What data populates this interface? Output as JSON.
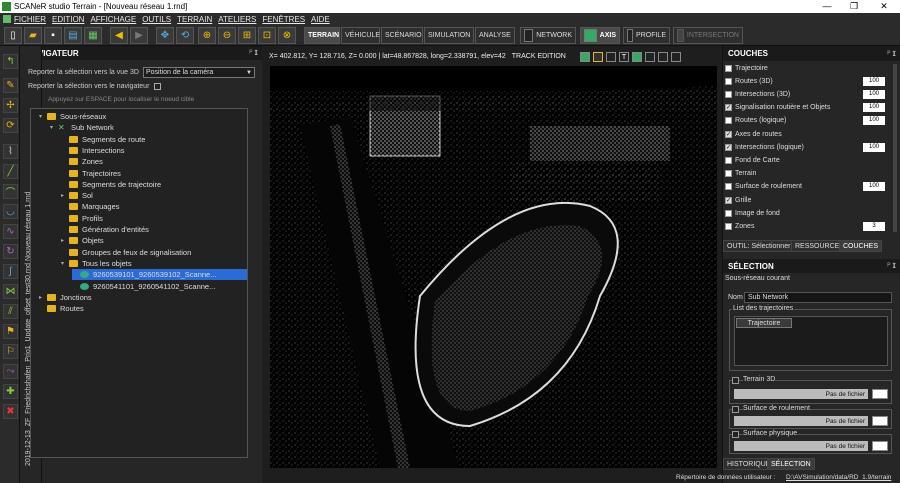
{
  "window": {
    "title": "SCANeR studio Terrain - [Nouveau réseau 1.rnd]",
    "minimize": "—",
    "maximize": "❐",
    "close": "✕"
  },
  "menu": [
    "FICHIER",
    "EDITION",
    "AFFICHAGE",
    "OUTILS",
    "TERRAIN",
    "ATELIERS",
    "FENÊTRES",
    "AIDE"
  ],
  "modes": {
    "terrain": "TERRAIN",
    "vehicule": "VÉHICULE",
    "scenario": "SCÉNARIO",
    "simulation": "SIMULATION",
    "analyse": "ANALYSE",
    "network": "NETWORK",
    "axis": "AXIS",
    "profile": "PROFILE",
    "intersection": "INTERSECTION"
  },
  "navigator": {
    "title": "NAVIGATEUR",
    "pin": "ᴾ 𝗜",
    "report_3d_label": "Reporter la sélection vers la vue 3D",
    "report_3d_value": "Position de la caméra",
    "report_nav_label": "Reporter la sélection vers le navigateur",
    "search_placeholder": "Appuyez sur ESPACE pour localiser le noeud cible",
    "tabs_vertical": "2019-12-13_ZF_Friedrichshafen_Prio1_Update_offset_test30.rnd    Nouveau réseau 1.rnd",
    "tree": [
      {
        "label": "Sous-réseaux",
        "level": 0,
        "arrow": "▾",
        "kind": "folder"
      },
      {
        "label": "Sub Network",
        "level": 1,
        "arrow": "▾",
        "kind": "network"
      },
      {
        "label": "Segments de route",
        "level": 2,
        "arrow": "",
        "kind": "folder"
      },
      {
        "label": "Intersections",
        "level": 2,
        "arrow": "",
        "kind": "folder"
      },
      {
        "label": "Zones",
        "level": 2,
        "arrow": "",
        "kind": "folder"
      },
      {
        "label": "Trajectoires",
        "level": 2,
        "arrow": "",
        "kind": "folder"
      },
      {
        "label": "Segments de trajectoire",
        "level": 2,
        "arrow": "",
        "kind": "folder"
      },
      {
        "label": "Sol",
        "level": 2,
        "arrow": "▸",
        "kind": "folder"
      },
      {
        "label": "Marquages",
        "level": 2,
        "arrow": "",
        "kind": "folder"
      },
      {
        "label": "Profils",
        "level": 2,
        "arrow": "",
        "kind": "folder"
      },
      {
        "label": "Génération d'entités",
        "level": 2,
        "arrow": "",
        "kind": "folder"
      },
      {
        "label": "Objets",
        "level": 2,
        "arrow": "▸",
        "kind": "folder"
      },
      {
        "label": "Groupes de feux de signalisation",
        "level": 2,
        "arrow": "",
        "kind": "folder"
      },
      {
        "label": "Tous les objets",
        "level": 2,
        "arrow": "▾",
        "kind": "folder"
      },
      {
        "label": "9260539101_9260539102_Scanne...",
        "level": 3,
        "arrow": "",
        "kind": "scan",
        "selected": true
      },
      {
        "label": "9260541101_9260541102_Scanne...",
        "level": 3,
        "arrow": "",
        "kind": "scan"
      },
      {
        "label": "Jonctions",
        "level": 0,
        "arrow": "▸",
        "kind": "folder"
      },
      {
        "label": "Routes",
        "level": 0,
        "arrow": "",
        "kind": "folder"
      }
    ]
  },
  "viewport": {
    "coords": "X= 402.812, Y= 128.716, Z=  0.000 | lat=48.867828, long=2.338791, elev=42",
    "track_edition": "TRACK EDITION"
  },
  "layers": {
    "title": "COUCHES",
    "pin": "ᴾ 𝗜",
    "items": [
      {
        "label": "Trajectoire",
        "checked": false,
        "value": null
      },
      {
        "label": "Routes (3D)",
        "checked": false,
        "value": "100"
      },
      {
        "label": "Intersections (3D)",
        "checked": false,
        "value": "100"
      },
      {
        "label": "Signalisation routière et Objets",
        "checked": true,
        "value": "100"
      },
      {
        "label": "Routes (logique)",
        "checked": false,
        "value": "100"
      },
      {
        "label": "Axes de routes",
        "checked": true,
        "value": null
      },
      {
        "label": "Intersections (logique)",
        "checked": true,
        "value": "100"
      },
      {
        "label": "Fond de Carte",
        "checked": false,
        "value": null
      },
      {
        "label": "Terrain",
        "checked": false,
        "value": null
      },
      {
        "label": "Surface de roulement",
        "checked": false,
        "value": "100"
      },
      {
        "label": "Grille",
        "checked": true,
        "value": null
      },
      {
        "label": "Image de fond",
        "checked": false,
        "value": null
      },
      {
        "label": "Zones",
        "checked": false,
        "value": "3"
      }
    ],
    "tabs": [
      "OUTIL: Sélectionner",
      "RESSOURCES",
      "COUCHES"
    ]
  },
  "selection": {
    "title": "SÉLECTION",
    "pin": "ᴾ 𝗜",
    "subtitle": "Sous-réseau courant",
    "nom_label": "Nom",
    "nom_value": "Sub Network",
    "traj_group": "List des trajectoires",
    "traj_item": "Trajectoire",
    "terrain3d": "Terrain 3D",
    "surface_roulement": "Surface de roulement",
    "surface_physique": "Surface physique",
    "pas_de_fichier": "Pas de fichier",
    "tabs": [
      "HISTORIQUE",
      "SÉLECTION"
    ]
  },
  "status": {
    "label": "Répertoire de données utilisateur :",
    "path": "D:\\AVSimulation/data/RD_1.9/terrain"
  },
  "colors": {
    "accent": "#e6b422",
    "selected": "#2a6bd6",
    "panel": "#262626"
  }
}
